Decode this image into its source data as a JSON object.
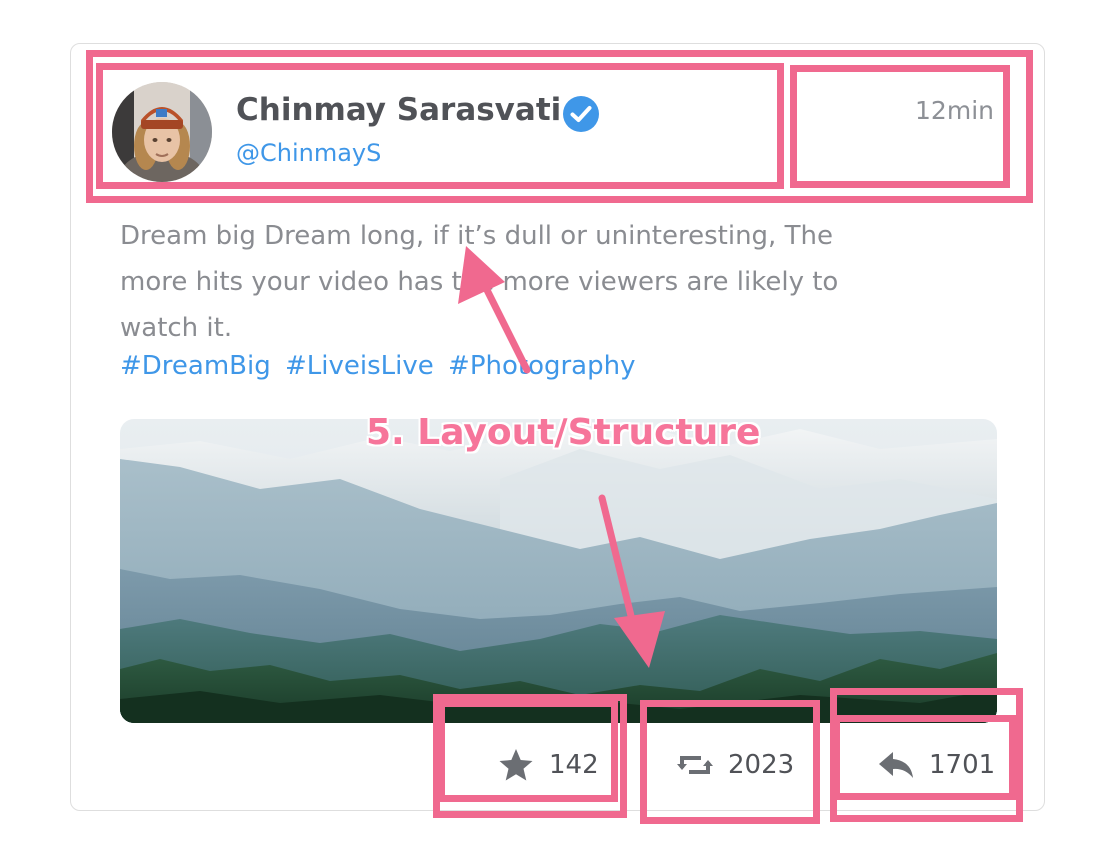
{
  "post": {
    "author": {
      "name": "Chinmay Sarasvati",
      "handle": "@ChinmayS",
      "verified": true
    },
    "timestamp": "12min",
    "text_lines": [
      "Dream big Dream long, if it’s dull or uninteresting, The",
      "more hits your video has the more viewers are likely to",
      "watch it."
    ],
    "hashtags": [
      "#DreamBig",
      "#LiveisLive",
      "#Photography"
    ],
    "image_description_icon": "mountain-landscape-photo",
    "actions": {
      "favorites": "142",
      "retweets": "2023",
      "replies": "1701"
    }
  },
  "annotation": {
    "label": "5. Layout/Structure",
    "color": "#f0698f"
  },
  "colors": {
    "accent": "#3f97e8",
    "name_text": "#505257",
    "body_text": "#8a8c91",
    "card_border": "#dedede"
  },
  "icons": {
    "verified": "verified-check-icon",
    "favorite": "star-icon",
    "retweet": "retweet-icon",
    "reply": "reply-arrow-icon"
  }
}
